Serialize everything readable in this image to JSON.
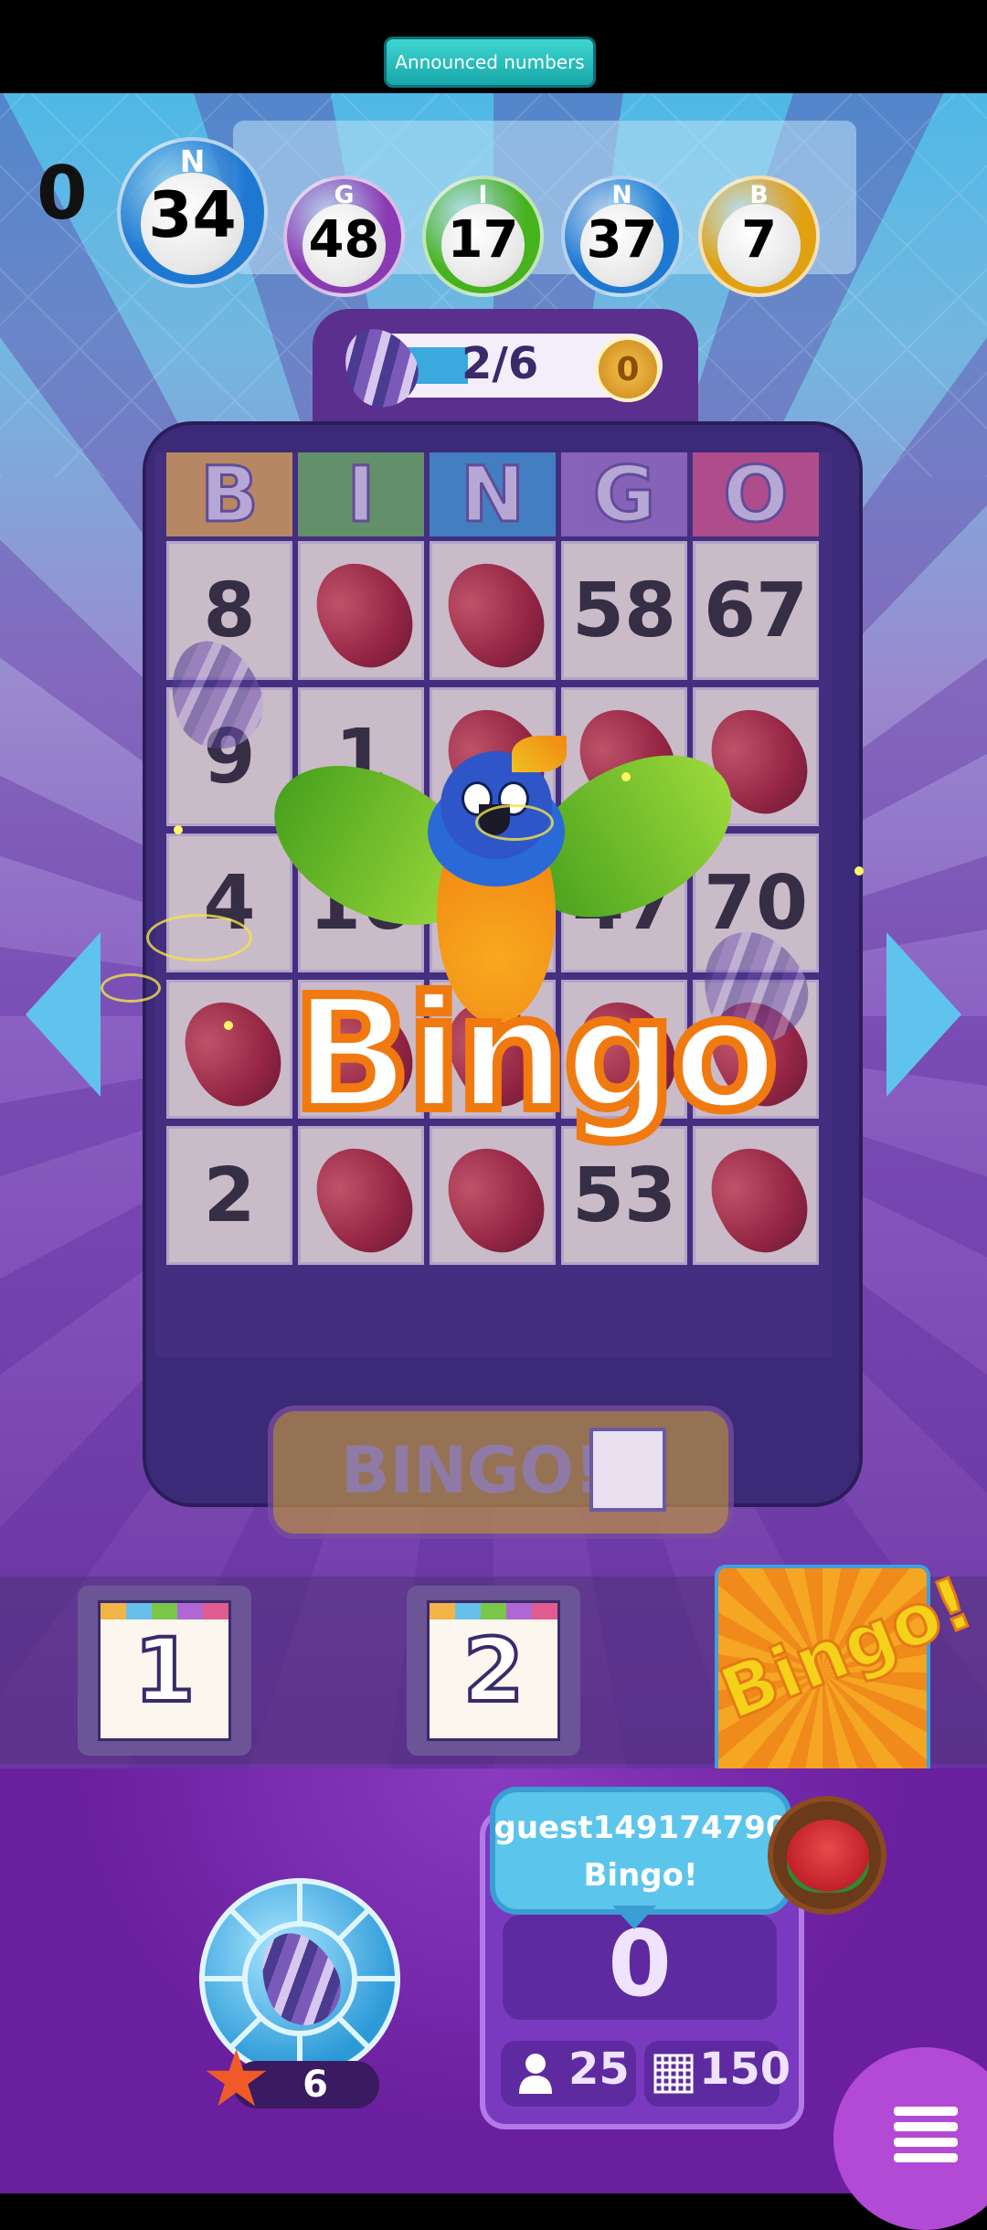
{
  "header": {
    "announced_label": "Announced numbers",
    "called_count": "0"
  },
  "called_balls": [
    {
      "letter": "N",
      "number": "34",
      "color": "#1e78d2"
    },
    {
      "letter": "G",
      "number": "48",
      "color": "#8a3ab2"
    },
    {
      "letter": "I",
      "number": "17",
      "color": "#46b21e"
    },
    {
      "letter": "N",
      "number": "37",
      "color": "#1e78d2"
    },
    {
      "letter": "B",
      "number": "7",
      "color": "#e0a010"
    }
  ],
  "progress": {
    "text": "2/6",
    "fraction": 0.333,
    "coins": "0"
  },
  "card": {
    "headers": [
      "B",
      "I",
      "N",
      "G",
      "O"
    ],
    "header_colors": [
      "#f0b54a",
      "#6ec257",
      "#3ba7dd",
      "#a77cd3",
      "#e55a8d"
    ],
    "rows": [
      [
        "8",
        "bean",
        "bean",
        "58",
        "67"
      ],
      [
        "9",
        "1",
        "bean",
        "bean",
        "bean"
      ],
      [
        "4",
        "16",
        "bean",
        "47",
        "70"
      ],
      [
        "bean",
        "bean",
        "bean",
        "bean",
        "bean"
      ],
      [
        "2",
        "bean",
        "bean",
        "53",
        "bean"
      ]
    ]
  },
  "overlay": {
    "bingo_banner": "Bingo"
  },
  "actions": {
    "bingo_button": "BINGO!"
  },
  "card_tabs": [
    {
      "label": "1"
    },
    {
      "label": "2"
    },
    {
      "label": "Bingo!"
    }
  ],
  "player": {
    "name": "guest149174790",
    "message": "Bingo!",
    "score": "0",
    "players_count": "25",
    "cards_count": "150",
    "avatar_icon": "watermelon-avatar-icon"
  },
  "booster": {
    "count": "6",
    "icon": "star-icon"
  },
  "menu": {
    "icon": "list-menu-icon"
  }
}
